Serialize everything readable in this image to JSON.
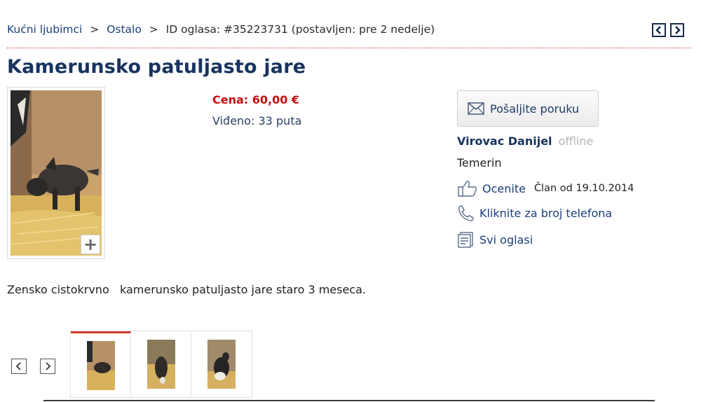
{
  "breadcrumb": {
    "cat1": "Kućni ljubimci",
    "sep1": ">",
    "cat2": "Ostalo",
    "sep2": ">",
    "id_text": "ID oglasa: #35223731 (postavljen: pre 2 nedelje)"
  },
  "ad": {
    "title": "Kamerunsko patuljasto jare",
    "price": "Cena: 60,00 €",
    "views": "Viđeno: 33 puta",
    "description": "Zensko cistokrvno   kamerunsko patuljasto jare staro 3 meseca."
  },
  "seller": {
    "send_message": "Pošaljite poruku",
    "name": "Virovac Danijel",
    "status": "offline",
    "city": "Temerin",
    "rate": "Ocenite",
    "member_since": "Član od 19.10.2014",
    "phone": "Kliknite za broj telefona",
    "all_ads": "Svi oglasi"
  },
  "gallery": {
    "zoom_symbol": "+",
    "thumbnail_count": 3,
    "active_index": 0
  },
  "colors": {
    "title": "#17335f",
    "price": "#c40f0f",
    "accent_red": "#d43a2a"
  },
  "icons": [
    "chevron-left-icon",
    "chevron-right-icon",
    "envelope-icon",
    "thumbs-up-icon",
    "phone-icon",
    "document-icon",
    "plus-icon"
  ]
}
